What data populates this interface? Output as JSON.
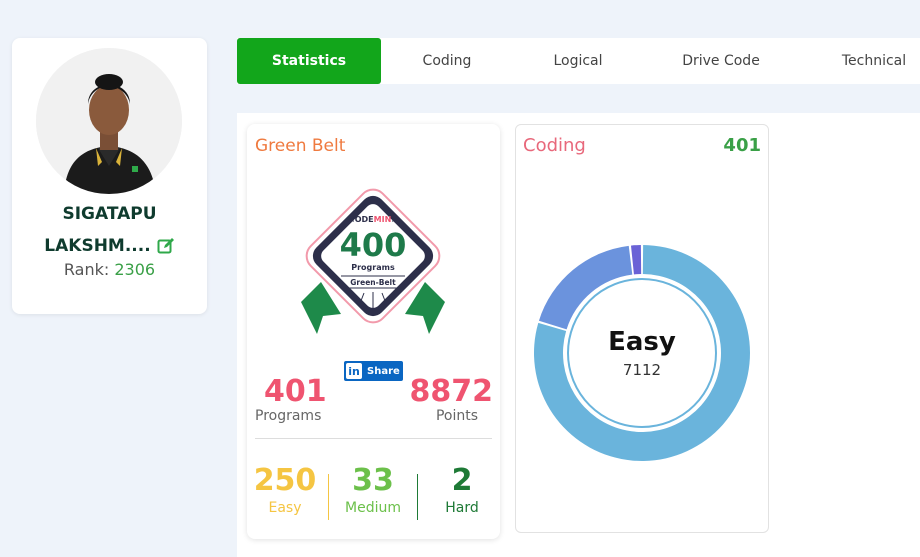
{
  "profile": {
    "name_line1": "SIGATAPU",
    "name_line2": "LAKSHM....",
    "rank_label": "Rank:",
    "rank_value": "2306"
  },
  "tabs": [
    {
      "label": "Statistics",
      "active": true
    },
    {
      "label": "Coding",
      "active": false
    },
    {
      "label": "Logical",
      "active": false
    },
    {
      "label": "Drive Code",
      "active": false
    },
    {
      "label": "Technical",
      "active": false
    }
  ],
  "belt_card": {
    "title": "Green Belt",
    "badge": {
      "brand_prefix": "<ODE",
      "brand_highlight": "MIN",
      "brand_suffix": ">",
      "number": "400",
      "unit": "Programs",
      "belt_name": "Green-Belt"
    },
    "share_label": "Share",
    "share_icon_text": "in",
    "programs_value": "401",
    "programs_label": "Programs",
    "points_value": "8872",
    "points_label": "Points",
    "difficulty": [
      {
        "value": "250",
        "label": "Easy",
        "color": "#f5c542"
      },
      {
        "value": "33",
        "label": "Medium",
        "color": "#6cc04a"
      },
      {
        "value": "2",
        "label": "Hard",
        "color": "#1e7a36"
      }
    ]
  },
  "coding_card": {
    "title": "Coding",
    "count": "401",
    "center_label": "Easy",
    "center_value": "7112"
  },
  "chart_data": {
    "type": "pie",
    "categories": [
      "Easy",
      "Medium",
      "Hard"
    ],
    "values": [
      7112,
      1655,
      160
    ],
    "colors": [
      "#6ab4dc",
      "#6b93dd",
      "#6a62d6"
    ]
  },
  "colors": {
    "accent_green": "#12a61b",
    "title_orange": "#ef7a3f",
    "stat_pink": "#ef5470",
    "linkedin_blue": "#0a66c2"
  }
}
